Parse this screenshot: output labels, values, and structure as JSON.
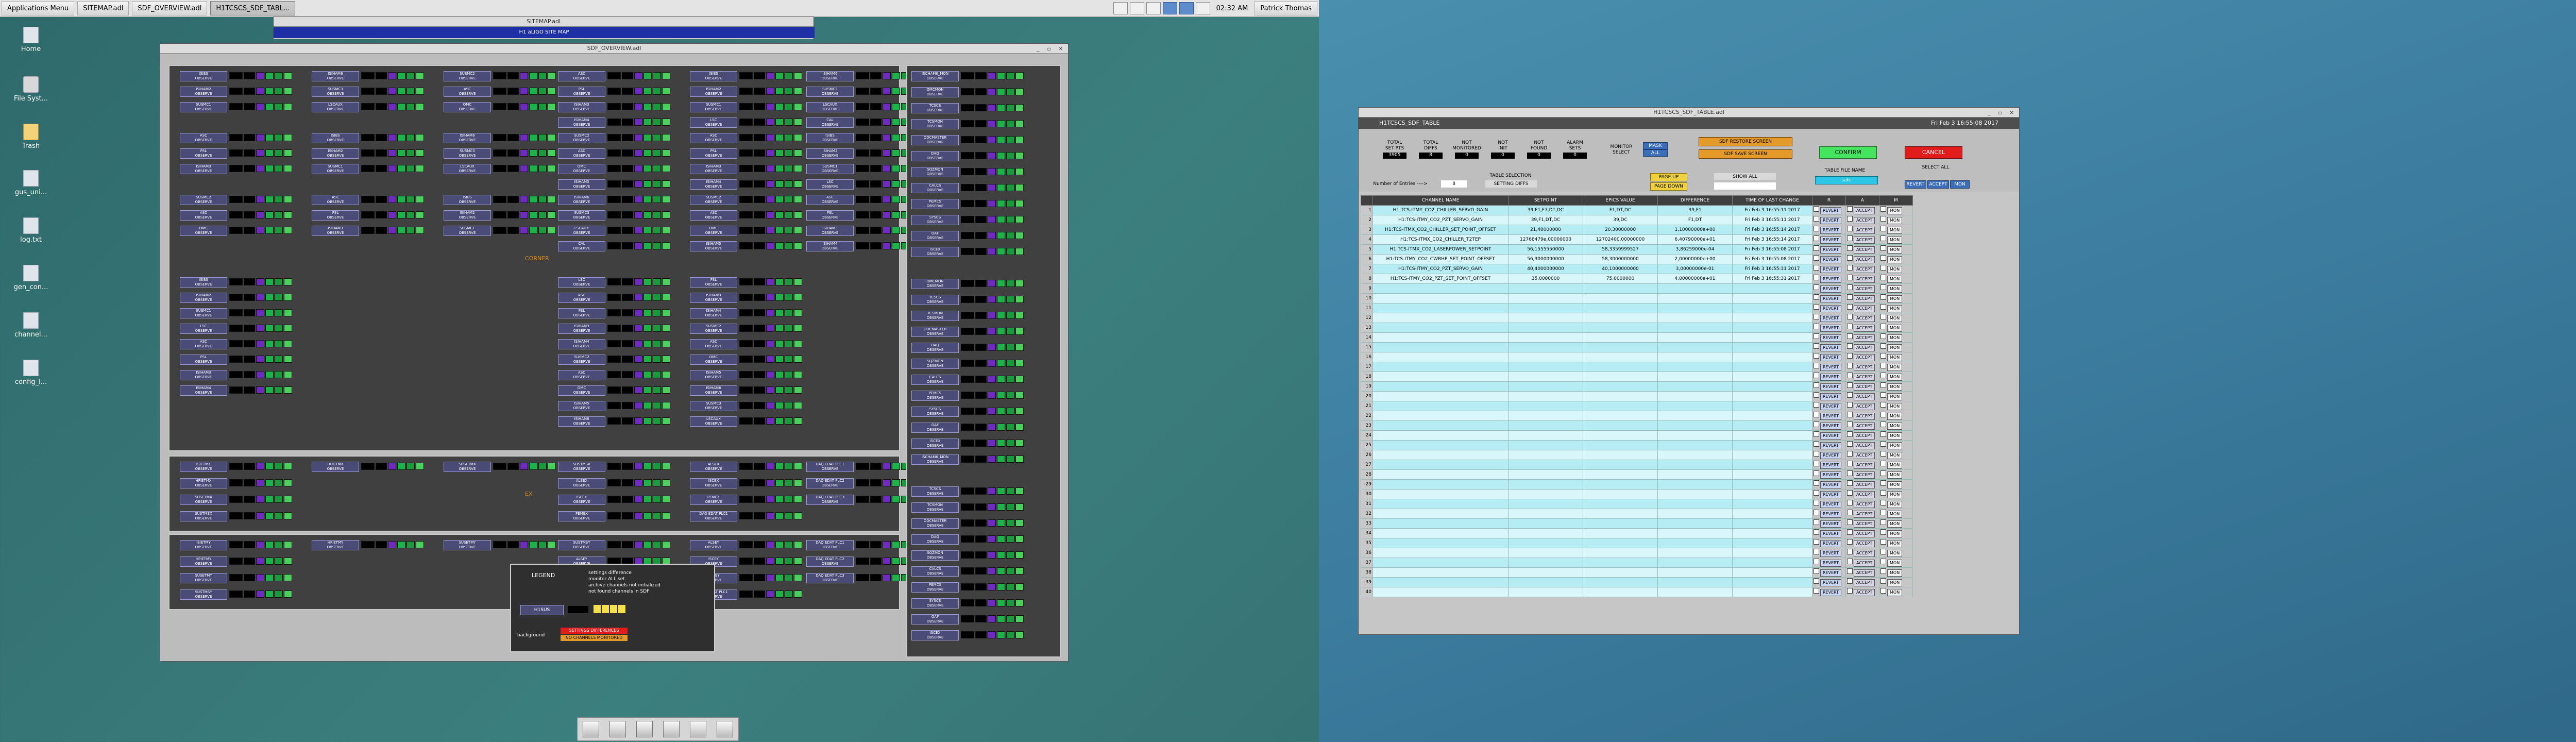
{
  "taskbar": {
    "apps_menu": "Applications Menu",
    "tasks": [
      "SITEMAP.adl",
      "SDF_OVERVIEW.adl",
      "H1TCSCS_SDF_TABL..."
    ],
    "clock": "02:32 AM",
    "user": "Patrick Thomas"
  },
  "desktop_icons": [
    "Home",
    "File Syst...",
    "Trash",
    "gus_uni...",
    "log.txt",
    "gen_con...",
    "channel...",
    "config_l..."
  ],
  "sitemap": {
    "title": "SITEMAP.adl",
    "banner_top": "",
    "banner": "H1 aLIGO SITE MAP"
  },
  "sdf_overview": {
    "title": "SDF_OVERVIEW.adl",
    "sections": [
      "CORNER",
      "EX",
      "EY"
    ],
    "legend": {
      "title": "LEGEND",
      "lines": [
        "settings difference",
        "monitor ALL set",
        "archive channels not initialized",
        "not found channels in SDF"
      ],
      "example": "H1SUS",
      "bad_label": "background",
      "status_red": "SETTINGS DIFFERENCES",
      "status_orange": "NO CHANNELS MONITORED"
    },
    "units": {
      "corner": [
        [
          "ISIBS",
          "ISIHAM2",
          "SUSMC1",
          "LSC",
          "ASC",
          "PSL"
        ],
        [
          "ISIHAM3",
          "ISIHAM4",
          "SUSMC2",
          "ASC",
          "OMC"
        ],
        [
          "ISIHAM5",
          "ISIHAM6",
          "SUSMC3",
          "LSCAUX",
          "CAL"
        ]
      ],
      "ex": [
        "ISIETMX",
        "HPIETMX",
        "SUSETMX",
        "SUSTMSX",
        "ALSEX",
        "ISCEX",
        "PEMEX",
        "DAQ EDAT PLC1",
        "DAQ EDAT PLC2",
        "DAQ EDAT PLC3"
      ],
      "ey": [
        "ISIETMY",
        "HPIETMY",
        "SUSETMY",
        "SUSTMSY",
        "ALSEY",
        "ISCEY",
        "PEMEY",
        "DAQ EDAT PLC1",
        "DAQ EDAT PLC2",
        "DAQ EDAT PLC3"
      ],
      "right": [
        "ISCHAM6_MON",
        "OMCMON",
        "TCSCS",
        "TCSMON",
        "ODCMASTER",
        "DAQ",
        "SQZMON",
        "CALCS",
        "PEMCS",
        "SYSCS",
        "OAF",
        "ISCEX"
      ]
    }
  },
  "hitc": {
    "title": "H1TCSCS_SDF_TABLE.adl",
    "system": "H1TCSCS_SDF_TABLE",
    "date": "Fri Feb  3 16:55:08 2017",
    "counts": [
      {
        "label": "TOTAL\nSET PTS",
        "value": "3905"
      },
      {
        "label": "TOTAL\nDIFFS",
        "value": "8"
      },
      {
        "label": "NOT\nMONITORED",
        "value": "0"
      },
      {
        "label": "NOT\nINIT",
        "value": "0"
      },
      {
        "label": "NOT\nFOUND",
        "value": "0"
      },
      {
        "label": "ALARM\nSETS",
        "value": "0"
      }
    ],
    "monitor_select": "MONITOR\nSELECT",
    "mon_mask": "MASK",
    "mon_all": "ALL",
    "sdf_restore": "SDF RESTORE SCREEN",
    "sdf_save": "SDF SAVE SCREEN",
    "confirm": "CONFIRM",
    "cancel": "CANCEL",
    "entries_label": "Number of Entries ---->",
    "entries_value": "8",
    "table_selection": "TABLE SELECTION",
    "table_select_value": "SETTING DIFFS",
    "page_up": "PAGE UP",
    "page_down": "PAGE DOWN",
    "show_all": "SHOW ALL",
    "table_file_name": "TABLE FILE NAME",
    "file_name_value": "safe",
    "select_all": "SELECT ALL",
    "revert": "REVERT",
    "accept": "ACCEPT",
    "mon": "MON",
    "columns": [
      "",
      "CHANNEL NAME",
      "SETPOINT",
      "EPICS VALUE",
      "DIFFERENCE",
      "TIME OF LAST CHANGE",
      "R",
      "A",
      "M"
    ],
    "rows": [
      [
        "1",
        "H1:TCS-ITMY_CO2_CHILLER_SERVO_GAIN",
        "39,F1,F7,DT,DC",
        "F1,DT,DC",
        "39,F1",
        "Fri Feb  3 16:55:11 2017"
      ],
      [
        "2",
        "H1:TCS-ITMY_CO2_PZT_SERVO_GAIN",
        "39,F1,DT,DC",
        "39,DC",
        "F1,DT",
        "Fri Feb  3 16:55:11 2017"
      ],
      [
        "3",
        "H1:TCS-ITMX_CO2_CHILLER_SET_POINT_OFFSET",
        "21,40000000",
        "20,30000000",
        "1,10000000e+00",
        "Fri Feb  3 16:55:14 2017"
      ],
      [
        "4",
        "H1:TCS-ITMX_CO2_CHILLER_T2TEP",
        "12766479e,00000000",
        "12702400,00000000",
        "6,40790000e+01",
        "Fri Feb  3 16:55:14 2017"
      ],
      [
        "5",
        "H1:TCS-ITMX_CO2_LASERPOWER_SETPOINT",
        "56,1555550000",
        "58,3359999527",
        "3,86259000e-04",
        "Fri Feb  3 16:55:08 2017"
      ],
      [
        "6",
        "H1:TCS-ITMY_CO2_CWRHP_SET_POINT_OFFSET",
        "56,3000000000",
        "58,3000000000",
        "2,00000000e+00",
        "Fri Feb  3 16:55:08 2017"
      ],
      [
        "7",
        "H1:TCS-ITMY_CO2_PZT_SERVO_GAIN",
        "40,4000000000",
        "40,1000000000",
        "3,00000000e-01",
        "Fri Feb  3 16:55:31 2017"
      ],
      [
        "8",
        "H1:TCS-ITMY_CO2_PZT_SET_POINT_OFFSET",
        "35,0000000",
        "75,0000000",
        "4,00000000e+01",
        "Fri Feb  3 16:55:31 2017"
      ]
    ],
    "row_count": "40"
  }
}
